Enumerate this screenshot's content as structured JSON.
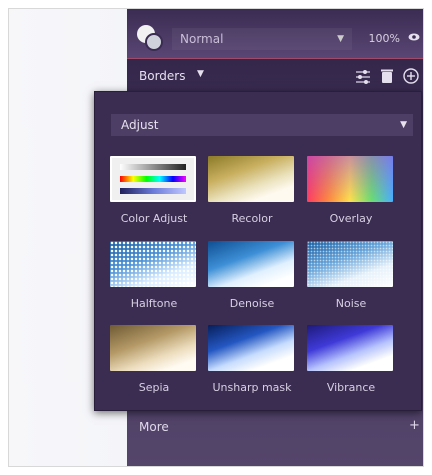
{
  "toolbar": {
    "blend_mode": "Normal",
    "opacity": "100%"
  },
  "section": {
    "title": "Borders"
  },
  "popup": {
    "dropdown_value": "Adjust",
    "filters": [
      {
        "label": "Color Adjust"
      },
      {
        "label": "Recolor"
      },
      {
        "label": "Overlay"
      },
      {
        "label": "Halftone"
      },
      {
        "label": "Denoise"
      },
      {
        "label": "Noise"
      },
      {
        "label": "Sepia"
      },
      {
        "label": "Unsharp mask"
      },
      {
        "label": "Vibrance"
      }
    ]
  },
  "footer": {
    "more_label": "More",
    "more_plus": "+"
  },
  "colors": {
    "panel_bg": "#3b2d52",
    "accent_line": "#a04a6a",
    "text": "#d8d0e2"
  },
  "icons": [
    "blend-mode-icon",
    "eye-icon",
    "dropdown-arrow-icon",
    "sliders-icon",
    "trash-icon",
    "add-circle-icon",
    "plus-icon"
  ]
}
